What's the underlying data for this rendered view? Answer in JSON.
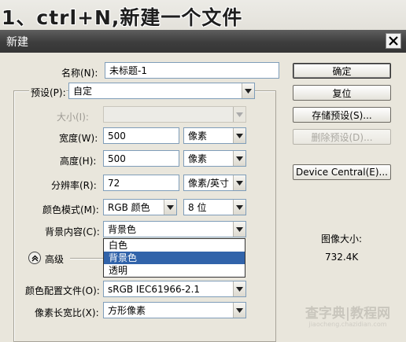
{
  "banner": {
    "text": "1、ctrl+N,新建一个文件"
  },
  "dialog": {
    "title": "新建",
    "fields": {
      "name": {
        "label": "名称(N):",
        "value": "未标题-1"
      },
      "preset": {
        "label": "预设(P):",
        "value": "自定"
      },
      "size": {
        "label": "大小(I):",
        "value": ""
      },
      "width": {
        "label": "宽度(W):",
        "value": "500",
        "unit": "像素"
      },
      "height": {
        "label": "高度(H):",
        "value": "500",
        "unit": "像素"
      },
      "resolution": {
        "label": "分辨率(R):",
        "value": "72",
        "unit": "像素/英寸"
      },
      "color_mode": {
        "label": "颜色模式(M):",
        "value": "RGB 颜色",
        "depth": "8 位"
      },
      "background": {
        "label": "背景内容(C):",
        "value": "背景色",
        "options": [
          "白色",
          "背景色",
          "透明"
        ],
        "highlighted": "背景色"
      },
      "advanced": {
        "label": "高级"
      },
      "color_profile": {
        "label": "颜色配置文件(O):",
        "value": "sRGB IEC61966-2.1"
      },
      "pixel_aspect": {
        "label": "像素长宽比(X):",
        "value": "方形像素"
      }
    },
    "buttons": {
      "ok": "确定",
      "reset": "复位",
      "save_preset": "存储预设(S)...",
      "delete_preset": "删除预设(D)...",
      "device_central": "Device Central(E)..."
    },
    "info": {
      "label": "图像大小:",
      "value": "732.4K"
    }
  },
  "watermark": {
    "line1": "查字典|教程网",
    "line2": "jiaocheng.chazidian.com"
  },
  "colors": {
    "titlebar": "#3d3d3d",
    "highlight": "#3163aa",
    "panel": "#e9e6dc"
  }
}
